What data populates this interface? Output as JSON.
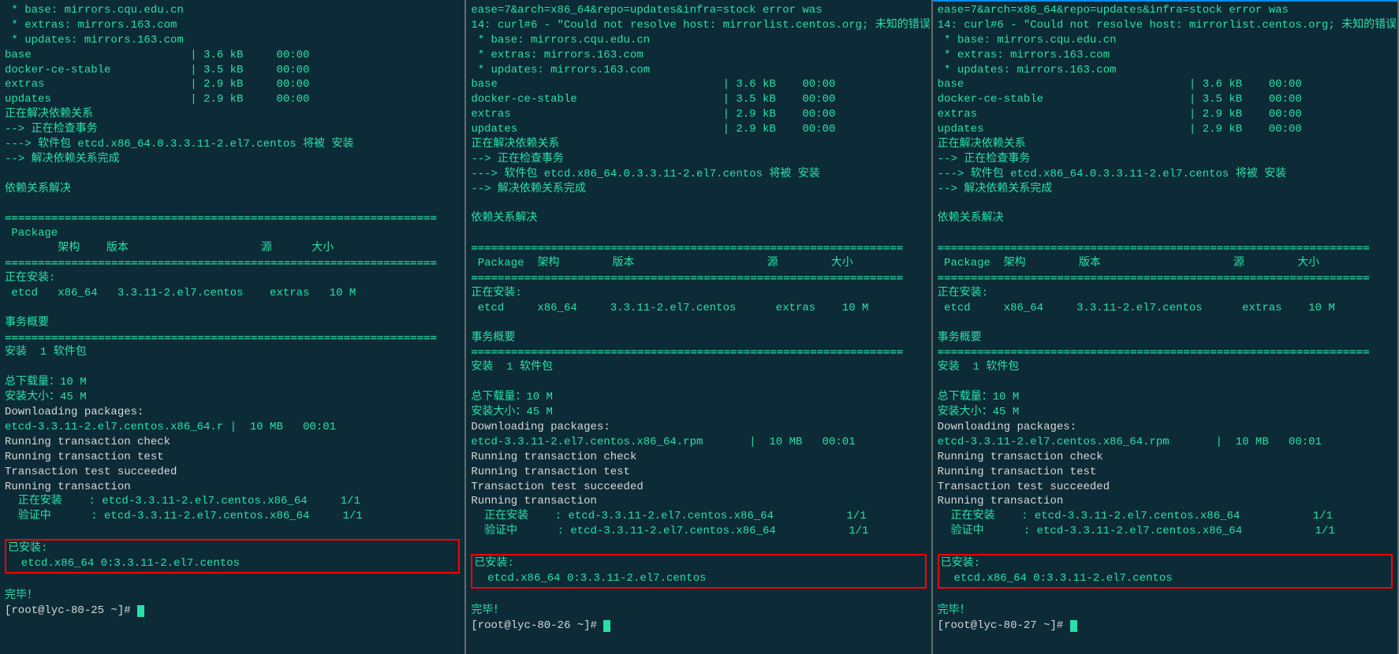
{
  "pane1": {
    "lines_top": [
      " * base: mirrors.cqu.edu.cn",
      " * extras: mirrors.163.com",
      " * updates: mirrors.163.com",
      "base                        | 3.6 kB     00:00",
      "docker-ce-stable            | 3.5 kB     00:00",
      "extras                      | 2.9 kB     00:00",
      "updates                     | 2.9 kB     00:00",
      "正在解决依赖关系",
      "--> 正在检查事务",
      "---> 软件包 etcd.x86_64.0.3.3.11-2.el7.centos 将被 安装",
      "--> 解决依赖关系完成",
      "",
      "依赖关系解决",
      ""
    ],
    "hdr1": " Package",
    "hdr2": "        架构    版本                    源      大小",
    "install_heading": "正在安装:",
    "install_row": " etcd   x86_64   3.3.11-2.el7.centos    extras   10 M",
    "summary_heading": "事务概要",
    "install_count": "安装  1 软件包",
    "dl_size": "总下载量：10 M",
    "inst_size": "安装大小：45 M",
    "downloading": "Downloading packages:",
    "dl_row": "etcd-3.3.11-2.el7.centos.x86_64.r |  10 MB   00:01",
    "trans": [
      "Running transaction check",
      "Running transaction test",
      "Transaction test succeeded",
      "Running transaction"
    ],
    "installing": "  正在安装    : etcd-3.3.11-2.el7.centos.x86_64     1/1",
    "verifying": "  验证中      : etcd-3.3.11-2.el7.centos.x86_64     1/1",
    "installed_hdr": "已安装:",
    "installed_pkg": "  etcd.x86_64 0:3.3.11-2.el7.centos",
    "done": "完毕！",
    "prompt": "[root@lyc-80-25 ~]# "
  },
  "pane2": {
    "lines_top": [
      "ease=7&arch=x86_64&repo=updates&infra=stock error was",
      "14: curl#6 - \"Could not resolve host: mirrorlist.centos.org; 未知的错误\"",
      " * base: mirrors.cqu.edu.cn",
      " * extras: mirrors.163.com",
      " * updates: mirrors.163.com",
      "base                                  | 3.6 kB    00:00",
      "docker-ce-stable                      | 3.5 kB    00:00",
      "extras                                | 2.9 kB    00:00",
      "updates                               | 2.9 kB    00:00",
      "正在解决依赖关系",
      "--> 正在检查事务",
      "---> 软件包 etcd.x86_64.0.3.3.11-2.el7.centos 将被 安装",
      "--> 解决依赖关系完成",
      "",
      "依赖关系解决",
      ""
    ],
    "hdr": " Package  架构        版本                    源        大小",
    "install_heading": "正在安装:",
    "install_row": " etcd     x86_64     3.3.11-2.el7.centos      extras    10 M",
    "summary_heading": "事务概要",
    "install_count": "安装  1 软件包",
    "dl_size": "总下载量：10 M",
    "inst_size": "安装大小：45 M",
    "downloading": "Downloading packages:",
    "dl_row": "etcd-3.3.11-2.el7.centos.x86_64.rpm       |  10 MB   00:01",
    "trans": [
      "Running transaction check",
      "Running transaction test",
      "Transaction test succeeded",
      "Running transaction"
    ],
    "installing": "  正在安装    : etcd-3.3.11-2.el7.centos.x86_64           1/1",
    "verifying": "  验证中      : etcd-3.3.11-2.el7.centos.x86_64           1/1",
    "installed_hdr": "已安装:",
    "installed_pkg": "  etcd.x86_64 0:3.3.11-2.el7.centos",
    "done": "完毕！",
    "prompt": "[root@lyc-80-26 ~]# "
  },
  "pane3": {
    "lines_top": [
      "ease=7&arch=x86_64&repo=updates&infra=stock error was",
      "14: curl#6 - \"Could not resolve host: mirrorlist.centos.org; 未知的错误\"",
      " * base: mirrors.cqu.edu.cn",
      " * extras: mirrors.163.com",
      " * updates: mirrors.163.com",
      "base                                  | 3.6 kB    00:00",
      "docker-ce-stable                      | 3.5 kB    00:00",
      "extras                                | 2.9 kB    00:00",
      "updates                               | 2.9 kB    00:00",
      "正在解决依赖关系",
      "--> 正在检查事务",
      "---> 软件包 etcd.x86_64.0.3.3.11-2.el7.centos 将被 安装",
      "--> 解决依赖关系完成",
      "",
      "依赖关系解决",
      ""
    ],
    "hdr": " Package  架构        版本                    源        大小",
    "install_heading": "正在安装:",
    "install_row": " etcd     x86_64     3.3.11-2.el7.centos      extras    10 M",
    "summary_heading": "事务概要",
    "install_count": "安装  1 软件包",
    "dl_size": "总下载量：10 M",
    "inst_size": "安装大小：45 M",
    "downloading": "Downloading packages:",
    "dl_row": "etcd-3.3.11-2.el7.centos.x86_64.rpm       |  10 MB   00:01",
    "trans": [
      "Running transaction check",
      "Running transaction test",
      "Transaction test succeeded",
      "Running transaction"
    ],
    "installing": "  正在安装    : etcd-3.3.11-2.el7.centos.x86_64           1/1",
    "verifying": "  验证中      : etcd-3.3.11-2.el7.centos.x86_64           1/1",
    "installed_hdr": "已安装:",
    "installed_pkg": "  etcd.x86_64 0:3.3.11-2.el7.centos",
    "done": "完毕！",
    "prompt": "[root@lyc-80-27 ~]# "
  },
  "separator": "================================================================="
}
